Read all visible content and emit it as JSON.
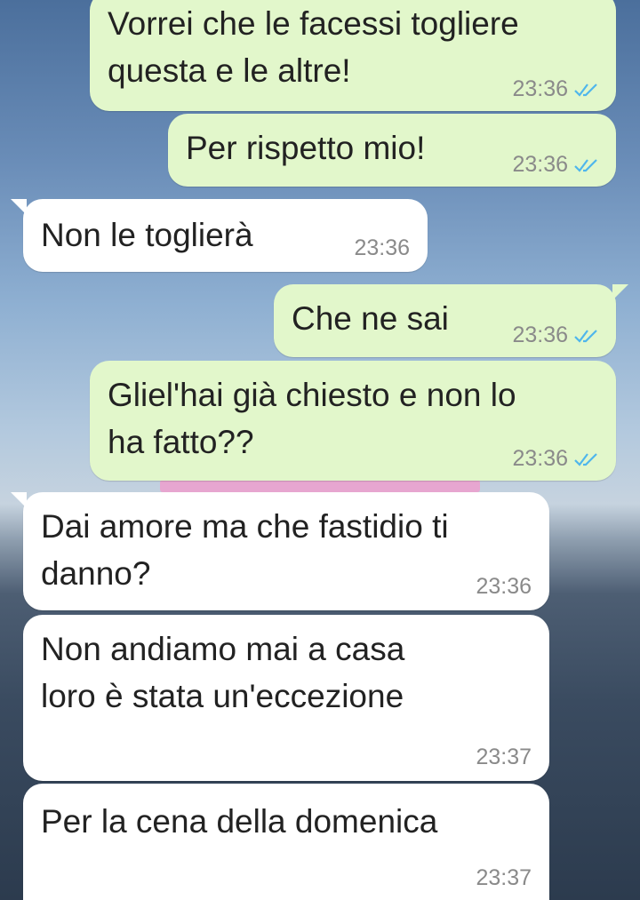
{
  "messages": [
    {
      "dir": "out",
      "lines": [
        "Vorrei che le facessi togliere",
        "questa e le altre!"
      ],
      "time": "23:36",
      "read": true
    },
    {
      "dir": "out",
      "lines": [
        "Per rispetto mio!"
      ],
      "time": "23:36",
      "read": true
    },
    {
      "dir": "in",
      "lines": [
        "Non le toglierà"
      ],
      "time": "23:36"
    },
    {
      "dir": "out",
      "lines": [
        "Che ne sai"
      ],
      "time": "23:36",
      "read": true
    },
    {
      "dir": "out",
      "lines": [
        "Gliel'hai già chiesto e non lo",
        "ha fatto??"
      ],
      "time": "23:36",
      "read": true
    },
    {
      "dir": "in",
      "lines": [
        "Dai amore ma che fastidio ti",
        "danno?"
      ],
      "time": "23:36"
    },
    {
      "dir": "in",
      "lines": [
        "Non andiamo mai a casa",
        "loro è stata un'eccezione"
      ],
      "time": "23:37"
    },
    {
      "dir": "in",
      "lines": [
        "Per la cena della domenica"
      ],
      "time": "23:37"
    }
  ],
  "colors": {
    "outgoing_bubble": "#e2f7cb",
    "incoming_bubble": "#ffffff",
    "read_ticks": "#4fb6ec",
    "timestamp": "#8a8a8a"
  },
  "icons": {
    "read_receipt": "double-check-icon"
  }
}
